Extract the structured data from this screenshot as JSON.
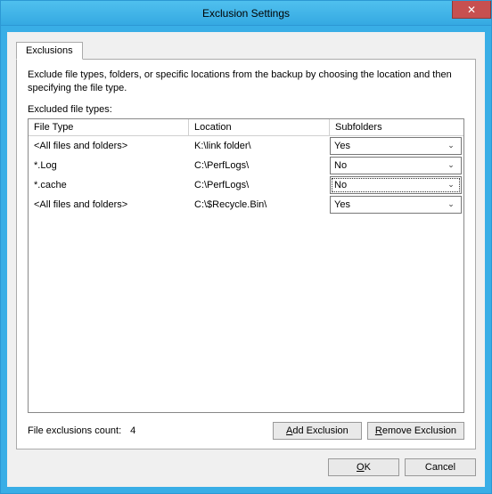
{
  "window": {
    "title": "Exclusion Settings"
  },
  "tabs": {
    "exclusions": "Exclusions"
  },
  "panel": {
    "description": "Exclude file types, folders, or specific locations from the backup by choosing the location and then specifying the file type.",
    "listLabel": "Excluded file types:"
  },
  "columns": {
    "fileType": "File Type",
    "location": "Location",
    "subfolders": "Subfolders"
  },
  "rows": [
    {
      "fileType": "<All files and folders>",
      "location": "K:\\link folder\\",
      "subfolders": "Yes",
      "focused": false
    },
    {
      "fileType": "*.Log",
      "location": "C:\\PerfLogs\\",
      "subfolders": "No",
      "focused": false
    },
    {
      "fileType": "*.cache",
      "location": "C:\\PerfLogs\\",
      "subfolders": "No",
      "focused": true
    },
    {
      "fileType": "<All files and folders>",
      "location": "C:\\$Recycle.Bin\\",
      "subfolders": "Yes",
      "focused": false
    }
  ],
  "footer": {
    "countLabel": "File exclusions count:",
    "countValue": "4",
    "addBtn": {
      "pre": "",
      "u": "A",
      "post": "dd Exclusion"
    },
    "removeBtn": {
      "pre": "",
      "u": "R",
      "post": "emove Exclusion"
    }
  },
  "dialog": {
    "ok": {
      "pre": "",
      "u": "O",
      "post": "K"
    },
    "cancel": "Cancel"
  }
}
